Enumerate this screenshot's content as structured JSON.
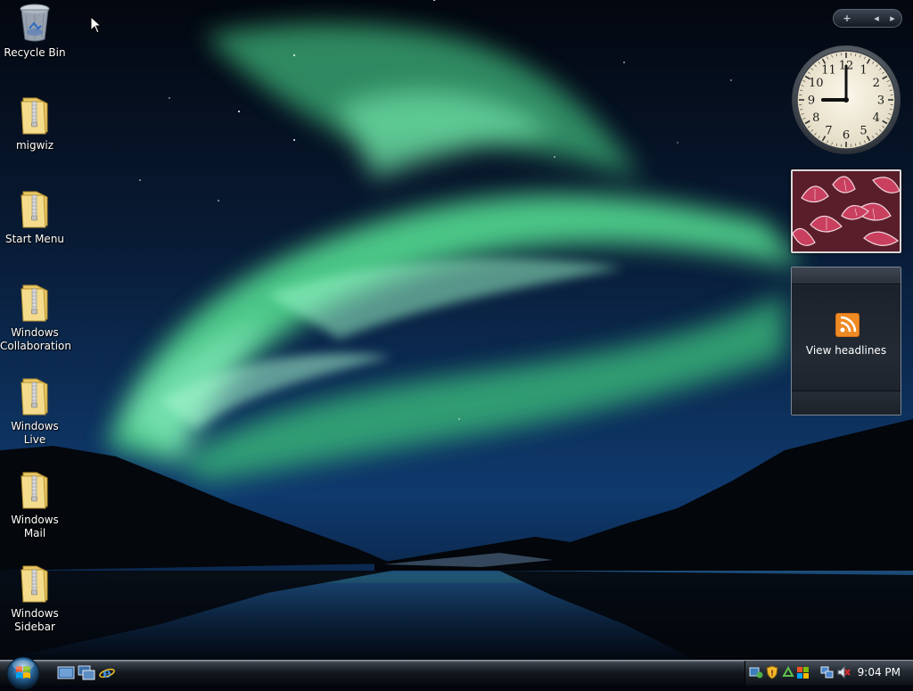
{
  "desktop": {
    "icons": [
      {
        "label": "Recycle Bin",
        "icon": "recycle-bin-icon"
      },
      {
        "label": "migwiz",
        "icon": "folder-zip-icon"
      },
      {
        "label": "Start Menu",
        "icon": "folder-zip-icon"
      },
      {
        "label": "Windows Collaboration",
        "icon": "folder-zip-icon"
      },
      {
        "label": "Windows Live",
        "icon": "folder-zip-icon"
      },
      {
        "label": "Windows Mail",
        "icon": "folder-zip-icon"
      },
      {
        "label": "Windows Sidebar",
        "icon": "folder-zip-icon"
      }
    ]
  },
  "sidebar": {
    "add_label": "+",
    "prev_label": "◂",
    "next_label": "▸",
    "clock": {
      "hour": 9,
      "minute": 0,
      "numerals": [
        "12",
        "1",
        "2",
        "3",
        "4",
        "5",
        "6",
        "7",
        "8",
        "9",
        "10",
        "11"
      ]
    },
    "feed": {
      "label": "View headlines",
      "icon": "rss-icon"
    }
  },
  "taskbar": {
    "start": "start-orb-icon",
    "quick_launch": [
      "show-desktop-icon",
      "switch-windows-icon",
      "internet-explorer-icon"
    ],
    "tray_icons": [
      "network-sync-icon",
      "security-shield-icon",
      "recycle-arrows-icon",
      "windows-update-icon",
      "network-icon",
      "volume-muted-icon"
    ],
    "time": "9:04 PM"
  },
  "colors": {
    "aurora": "#5fe0a0",
    "sky": "#0f2a5a",
    "taskbar": "#151a20"
  }
}
